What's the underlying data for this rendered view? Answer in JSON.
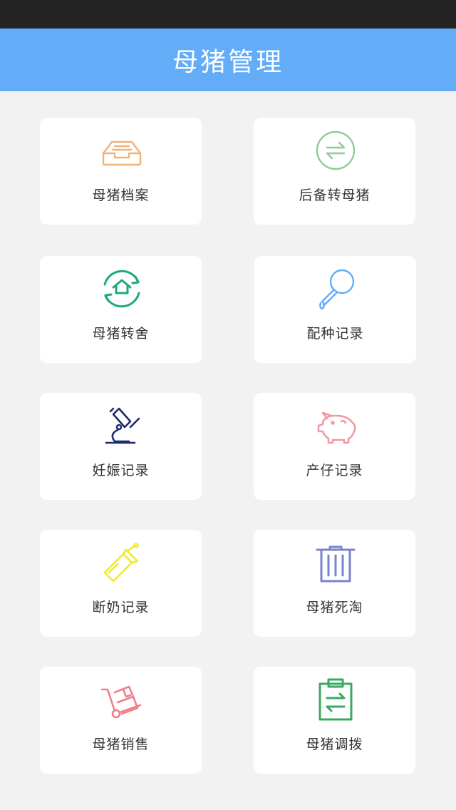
{
  "header": {
    "title": "母猪管理"
  },
  "menu": {
    "items": [
      {
        "label": "母猪档案",
        "icon": "inbox-tray-icon",
        "color": "#efb27a"
      },
      {
        "label": "后备转母猪",
        "icon": "exchange-circle-icon",
        "color": "#8fcc96"
      },
      {
        "label": "母猪转舍",
        "icon": "house-refresh-icon",
        "color": "#1aaa7e"
      },
      {
        "label": "配种记录",
        "icon": "dropper-icon",
        "color": "#62acf8"
      },
      {
        "label": "妊娠记录",
        "icon": "microscope-icon",
        "color": "#1d2a6e"
      },
      {
        "label": "产仔记录",
        "icon": "piggy-icon",
        "color": "#ef9aa0"
      },
      {
        "label": "断奶记录",
        "icon": "baby-bottle-icon",
        "color": "#f2e92a"
      },
      {
        "label": "母猪死淘",
        "icon": "trash-icon",
        "color": "#7a83d2"
      },
      {
        "label": "母猪销售",
        "icon": "hand-truck-icon",
        "color": "#ef8088"
      },
      {
        "label": "母猪调拨",
        "icon": "clipboard-transfer-icon",
        "color": "#3aa862"
      }
    ]
  }
}
